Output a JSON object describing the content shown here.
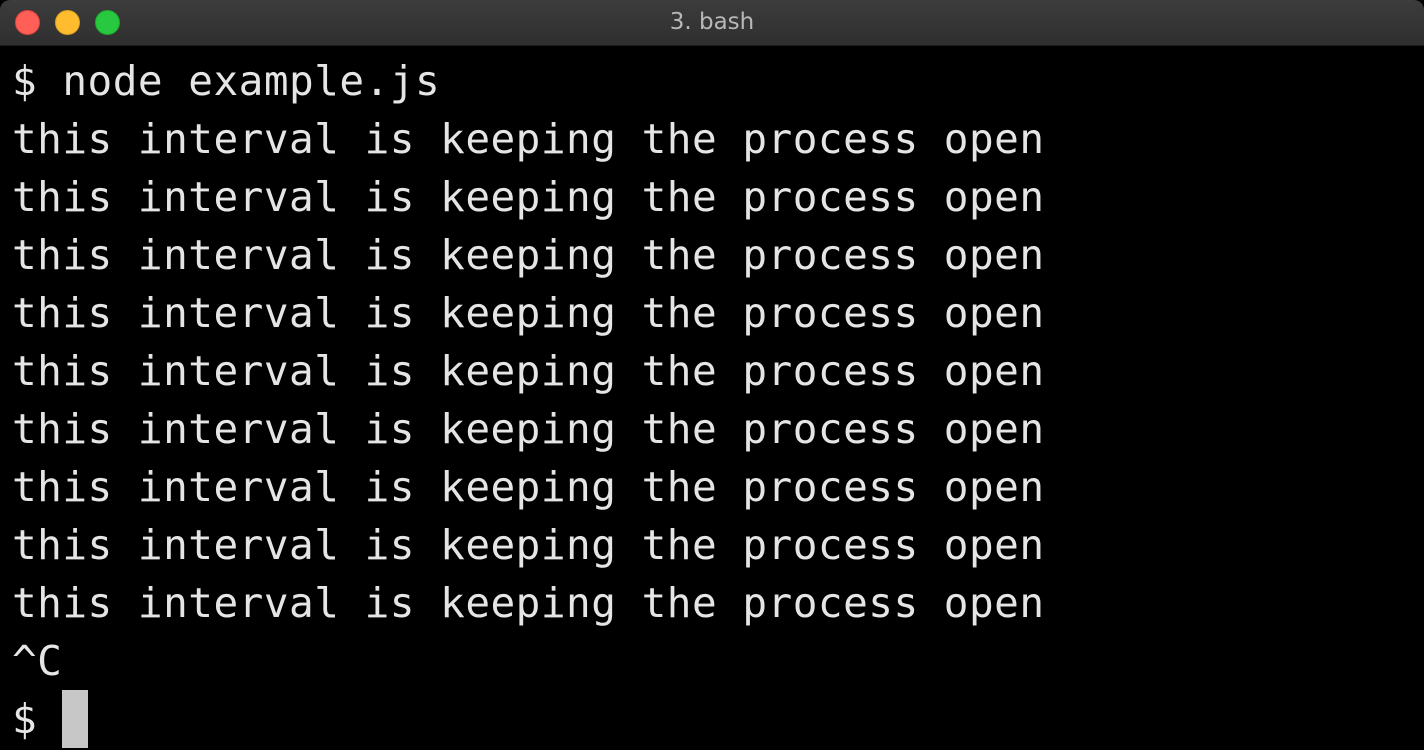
{
  "window": {
    "title": "3. bash",
    "colors": {
      "close": "#ff5f57",
      "minimize": "#febc2e",
      "zoom": "#28c840",
      "background": "#000000",
      "text": "#e5e5e5"
    }
  },
  "terminal": {
    "lines": [
      "$ node example.js",
      "this interval is keeping the process open",
      "this interval is keeping the process open",
      "this interval is keeping the process open",
      "this interval is keeping the process open",
      "this interval is keeping the process open",
      "this interval is keeping the process open",
      "this interval is keeping the process open",
      "this interval is keeping the process open",
      "this interval is keeping the process open",
      "^C"
    ],
    "prompt": "$ "
  }
}
